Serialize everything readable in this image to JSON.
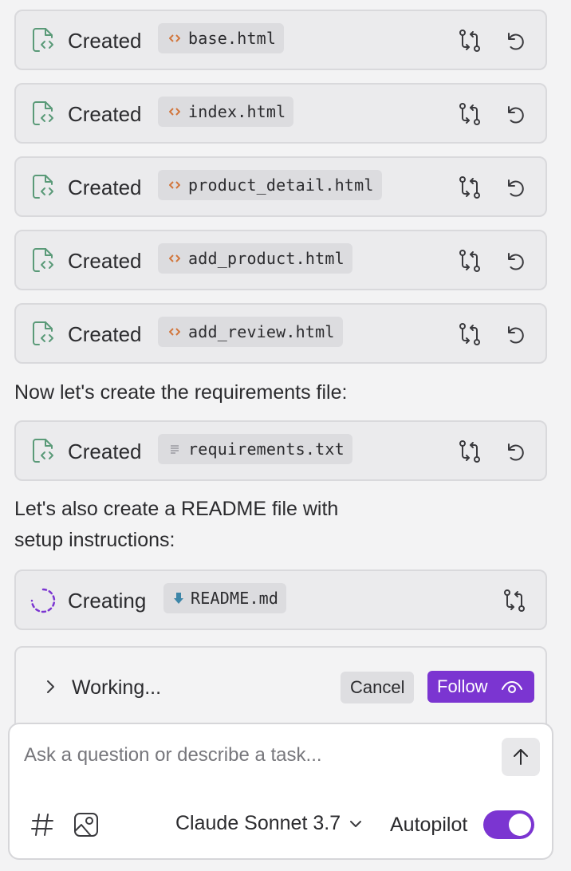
{
  "files": [
    {
      "status": "Created",
      "name": "base.html",
      "type": "html"
    },
    {
      "status": "Created",
      "name": "index.html",
      "type": "html"
    },
    {
      "status": "Created",
      "name": "product_detail.html",
      "type": "html"
    },
    {
      "status": "Created",
      "name": "add_product.html",
      "type": "html"
    },
    {
      "status": "Created",
      "name": "add_review.html",
      "type": "html"
    },
    {
      "status": "Created",
      "name": "requirements.txt",
      "type": "text"
    },
    {
      "status": "Creating",
      "name": "README.md",
      "type": "markdown"
    }
  ],
  "messages": {
    "requirements_intro": "Now let's create the requirements file:",
    "readme_intro_line1": "Let's also create a README file with",
    "readme_intro_line2": "setup instructions:"
  },
  "working": {
    "label": "Working...",
    "cancel_label": "Cancel",
    "follow_label": "Follow"
  },
  "composer": {
    "placeholder": "Ask a question or describe a task...",
    "model": "Claude Sonnet 3.7",
    "autopilot_label": "Autopilot",
    "autopilot_on": true
  },
  "colors": {
    "accent": "#7b35d1",
    "created_icon": "#5a9a78",
    "html_icon": "#d2763c",
    "markdown_icon": "#3d86a8"
  },
  "icons": {
    "created": "file-code-icon",
    "creating": "spinner-icon",
    "diff": "compare-icon",
    "revert": "undo-icon"
  }
}
